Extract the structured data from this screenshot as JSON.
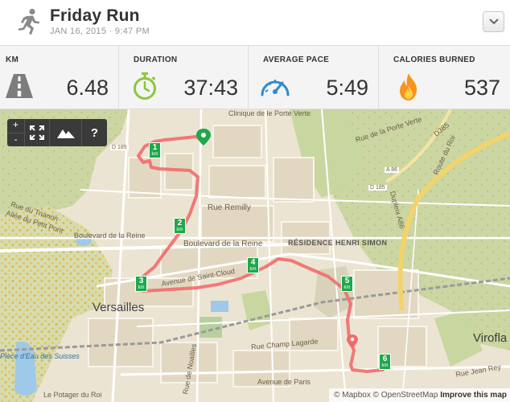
{
  "activity": {
    "icon": "runner-icon",
    "title": "Friday Run",
    "date_time": "JAN 16, 2015  ·  9:47 PM"
  },
  "stats": [
    {
      "label": "KM",
      "value": "6.48",
      "icon": "road-icon"
    },
    {
      "label": "DURATION",
      "value": "37:43",
      "icon": "stopwatch-icon"
    },
    {
      "label": "AVERAGE PACE",
      "value": "5:49",
      "icon": "speedometer-icon"
    },
    {
      "label": "CALORIES BURNED",
      "value": "537",
      "icon": "flame-icon"
    }
  ],
  "colors": {
    "route": "#f26b6b",
    "km_marker": "#1ea84a",
    "stopwatch": "#8cc63f",
    "speedometer": "#2e8bd1",
    "flame": "#f7941d"
  },
  "map": {
    "controls": {
      "zoom_in": "+",
      "zoom_out": "-",
      "help": "?"
    },
    "km_markers": [
      "1",
      "2",
      "3",
      "4",
      "5",
      "6"
    ],
    "km_unit": "km",
    "labels": {
      "clinique": "Clinique de le Porte Verte",
      "rue_remilly": "Rue Remilly",
      "bd_reine_1": "Boulevard de la Reine",
      "bd_reine_2": "Boulevard de la Reine",
      "allee_petit_pont": "Allée du Petit Pont",
      "avenue_saint_cloud": "Avenue de Saint-Cloud",
      "residence": "RÉSIDENCE HENRI SIMON",
      "versailles": "Versailles",
      "viroflay": "Virofla",
      "rue_champ_lagarde": "Rue Champ Lagarde",
      "avenue_de_paris": "Avenue de Paris",
      "rue_jean_rey": "Rue Jean Rey",
      "piece_deau": "Pièce d'Eau des Suisses",
      "potager": "Le Potager du Roi",
      "porte_verte": "Rue de la Porte Verte",
      "d185": "D 185",
      "d185b": "D 185",
      "a86": "A 86",
      "d385": "D385",
      "route_roi": "Route du Roi",
      "dupleix": "Dupleix A86",
      "rue_noailles": "Rue de Noailles",
      "rue_trianon": "Rue du Trianon"
    },
    "attribution": {
      "mapbox": "© Mapbox",
      "osm": "© OpenStreetMap",
      "improve": "Improve this map"
    }
  }
}
